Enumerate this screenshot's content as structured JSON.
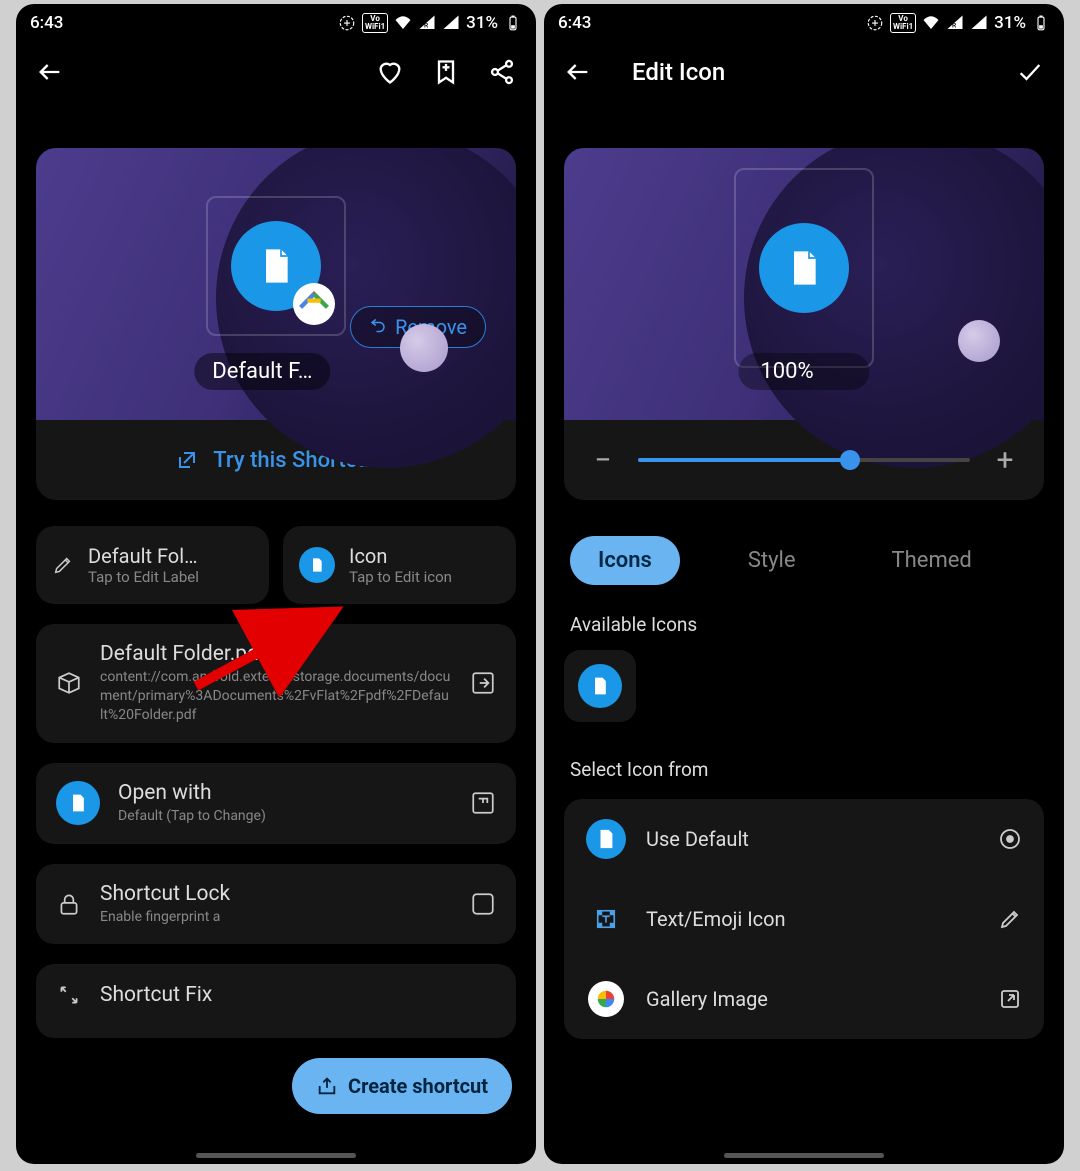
{
  "status": {
    "time": "6:43",
    "battery": "31%"
  },
  "screen1": {
    "preview": {
      "label": "Default F…",
      "remove": "Remove"
    },
    "try": "Try this Shortcut",
    "labelCard": {
      "title": "Default Fol…",
      "sub": "Tap to Edit Label"
    },
    "iconCard": {
      "title": "Icon",
      "sub": "Tap to Edit icon"
    },
    "file": {
      "title": "Default Folder.pdf",
      "sub": "content://com.android.externalstorage.documents/document/primary%3ADocuments%2FvFlat%2Fpdf%2FDefault%20Folder.pdf"
    },
    "openWith": {
      "title": "Open with",
      "sub": "Default (Tap to Change)"
    },
    "lock": {
      "title": "Shortcut Lock",
      "sub": "Enable fingerprint a"
    },
    "fix": {
      "title": "Shortcut Fix"
    },
    "fab": "Create shortcut"
  },
  "screen2": {
    "title": "Edit Icon",
    "zoom": "100%",
    "tabs": {
      "icons": "Icons",
      "style": "Style",
      "themed": "Themed"
    },
    "available": "Available Icons",
    "selectFrom": "Select Icon from",
    "sources": {
      "default": "Use Default",
      "text": "Text/Emoji Icon",
      "gallery": "Gallery Image"
    }
  }
}
